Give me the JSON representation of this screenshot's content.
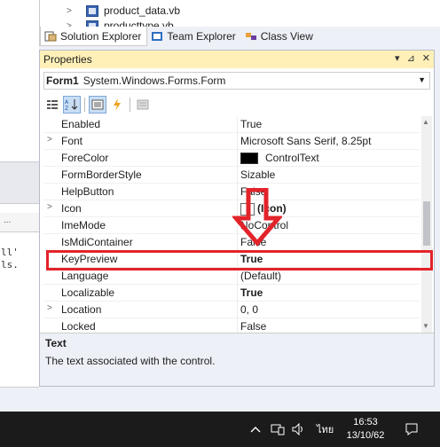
{
  "left_pane": {
    "tab_fragment": "...",
    "code_lines": [
      "ll'",
      "ls."
    ]
  },
  "solution_explorer": {
    "files": [
      {
        "name": "product_data.vb",
        "icon": "vb-file-icon"
      },
      {
        "name": "producttype.vb",
        "icon": "vb-file-icon"
      }
    ]
  },
  "tool_tabs": [
    {
      "label": "Solution Explorer",
      "icon": "solution-explorer-icon",
      "active": true
    },
    {
      "label": "Team Explorer",
      "icon": "team-explorer-icon",
      "active": false
    },
    {
      "label": "Class View",
      "icon": "class-view-icon",
      "active": false
    }
  ],
  "properties": {
    "title": "Properties",
    "title_controls": [
      "▾",
      "⊿",
      "✕"
    ],
    "object_name": "Form1",
    "object_type": "System.Windows.Forms.Form",
    "rows": [
      {
        "name": "Enabled",
        "value": "True",
        "expandable": false,
        "bold": false
      },
      {
        "name": "Font",
        "value": "Microsoft Sans Serif, 8.25pt",
        "expandable": true,
        "bold": false
      },
      {
        "name": "ForeColor",
        "value": "ControlText",
        "expandable": false,
        "bold": false,
        "swatch": "#000000"
      },
      {
        "name": "FormBorderStyle",
        "value": "Sizable",
        "expandable": false,
        "bold": false
      },
      {
        "name": "HelpButton",
        "value": "False",
        "expandable": false,
        "bold": false
      },
      {
        "name": "Icon",
        "value": "(Icon)",
        "expandable": true,
        "bold": true,
        "has_icon": true
      },
      {
        "name": "ImeMode",
        "value": "NoControl",
        "expandable": false,
        "bold": false
      },
      {
        "name": "IsMdiContainer",
        "value": "False",
        "expandable": false,
        "bold": false
      },
      {
        "name": "KeyPreview",
        "value": "True",
        "expandable": false,
        "bold": true
      },
      {
        "name": "Language",
        "value": "(Default)",
        "expandable": false,
        "bold": false
      },
      {
        "name": "Localizable",
        "value": "True",
        "expandable": false,
        "bold": true
      },
      {
        "name": "Location",
        "value": "0, 0",
        "expandable": true,
        "bold": false
      },
      {
        "name": "Locked",
        "value": "False",
        "expandable": false,
        "bold": false
      }
    ],
    "description": {
      "title": "Text",
      "text": "The text associated with the control."
    }
  },
  "annotation": {
    "highlight_color": "#e3232a",
    "highlighted_property": "KeyPreview"
  },
  "taskbar": {
    "language": "ไทย",
    "time": "16:53",
    "date": "13/10/62"
  }
}
